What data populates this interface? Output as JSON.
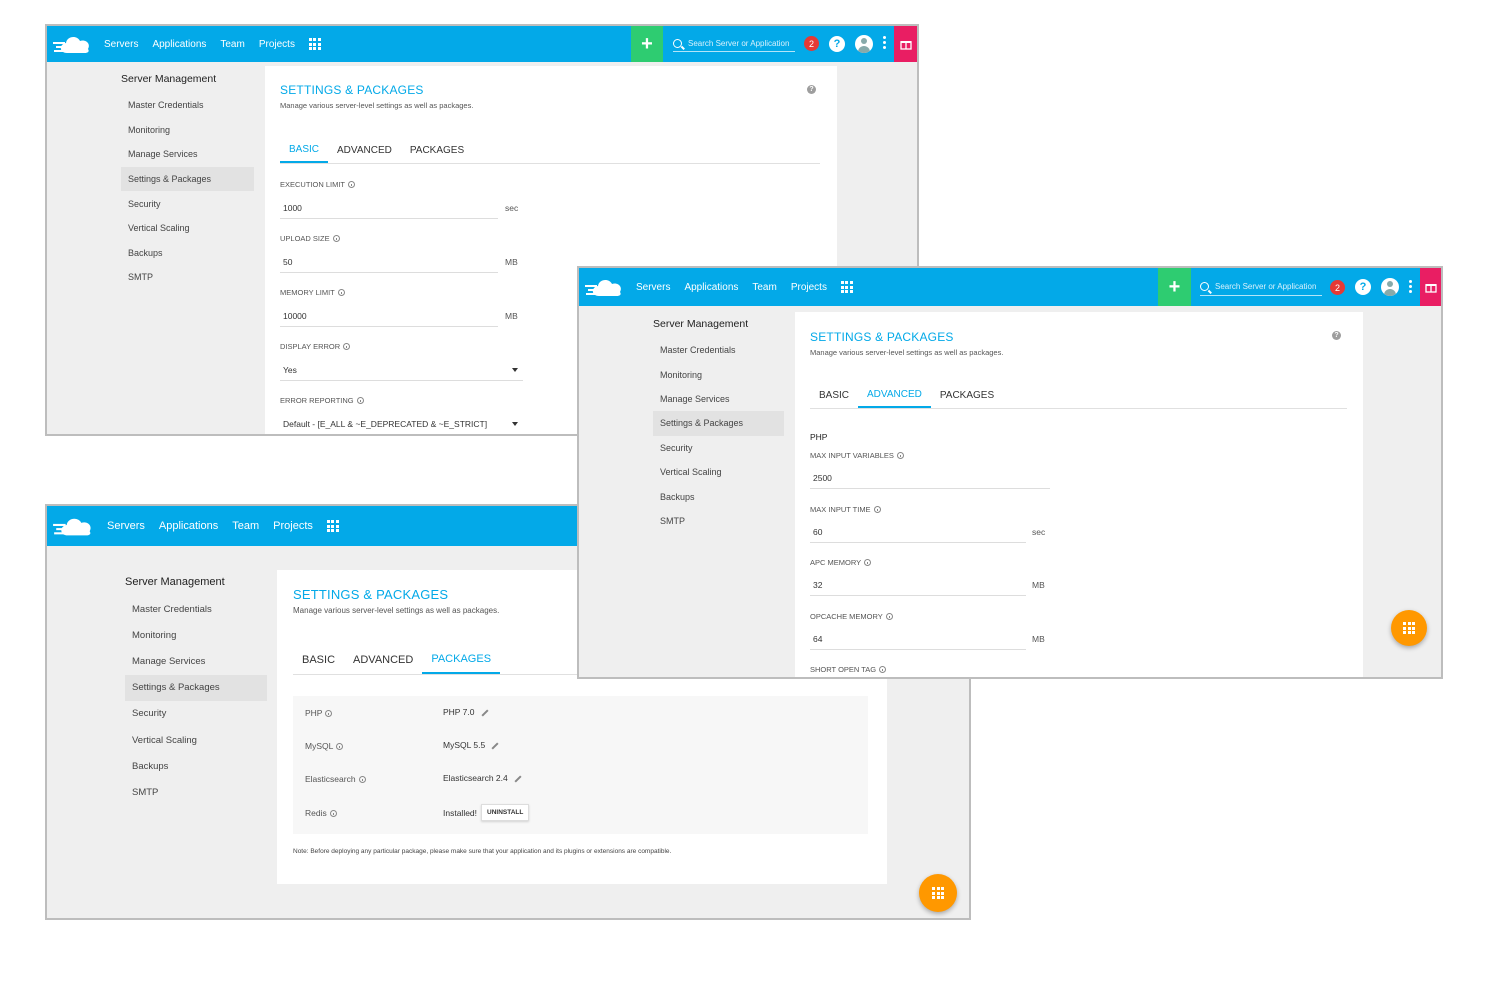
{
  "nav": {
    "servers": "Servers",
    "applications": "Applications",
    "team": "Team",
    "projects": "Projects",
    "search_placeholder": "Search Server or Application",
    "notification_count": "2",
    "help": "?"
  },
  "sidebar": {
    "title": "Server Management",
    "items": [
      {
        "label": "Master Credentials"
      },
      {
        "label": "Monitoring"
      },
      {
        "label": "Manage Services"
      },
      {
        "label": "Settings & Packages"
      },
      {
        "label": "Security"
      },
      {
        "label": "Vertical Scaling"
      },
      {
        "label": "Backups"
      },
      {
        "label": "SMTP"
      }
    ]
  },
  "page": {
    "title": "SETTINGS & PACKAGES",
    "subtitle": "Manage various server-level settings as well as packages."
  },
  "tabs": {
    "basic": "BASIC",
    "advanced": "ADVANCED",
    "packages": "PACKAGES"
  },
  "basic": {
    "execution_limit": {
      "label": "EXECUTION LIMIT",
      "value": "1000",
      "unit": "sec"
    },
    "upload_size": {
      "label": "UPLOAD SIZE",
      "value": "50",
      "unit": "MB"
    },
    "memory_limit": {
      "label": "MEMORY LIMIT",
      "value": "10000",
      "unit": "MB"
    },
    "display_error": {
      "label": "DISPLAY ERROR",
      "value": "Yes"
    },
    "error_reporting": {
      "label": "ERROR REPORTING",
      "value": "Default - [E_ALL & ~E_DEPRECATED & ~E_STRICT]"
    }
  },
  "advanced": {
    "section": "PHP",
    "max_input_variables": {
      "label": "MAX INPUT VARIABLES",
      "value": "2500"
    },
    "max_input_time": {
      "label": "MAX INPUT TIME",
      "value": "60",
      "unit": "sec"
    },
    "apc_memory": {
      "label": "APC MEMORY",
      "value": "32",
      "unit": "MB"
    },
    "opcache_memory": {
      "label": "OPCACHE MEMORY",
      "value": "64",
      "unit": "MB"
    },
    "short_open_tag": {
      "label": "SHORT OPEN TAG"
    }
  },
  "packages": {
    "rows": [
      {
        "name": "PHP",
        "value": "PHP 7.0"
      },
      {
        "name": "MySQL",
        "value": "MySQL 5.5"
      },
      {
        "name": "Elasticsearch",
        "value": "Elasticsearch 2.4"
      },
      {
        "name": "Redis",
        "value": "Installed!"
      }
    ],
    "uninstall_label": "UNINSTALL",
    "note": "Note: Before deploying any particular package, please make sure that your application and its plugins or extensions are compatible."
  },
  "colors": {
    "brand": "#03a9e8",
    "add": "#2ecc71",
    "gift": "#e91e63",
    "badge": "#e53935",
    "fab": "#ff9800"
  }
}
